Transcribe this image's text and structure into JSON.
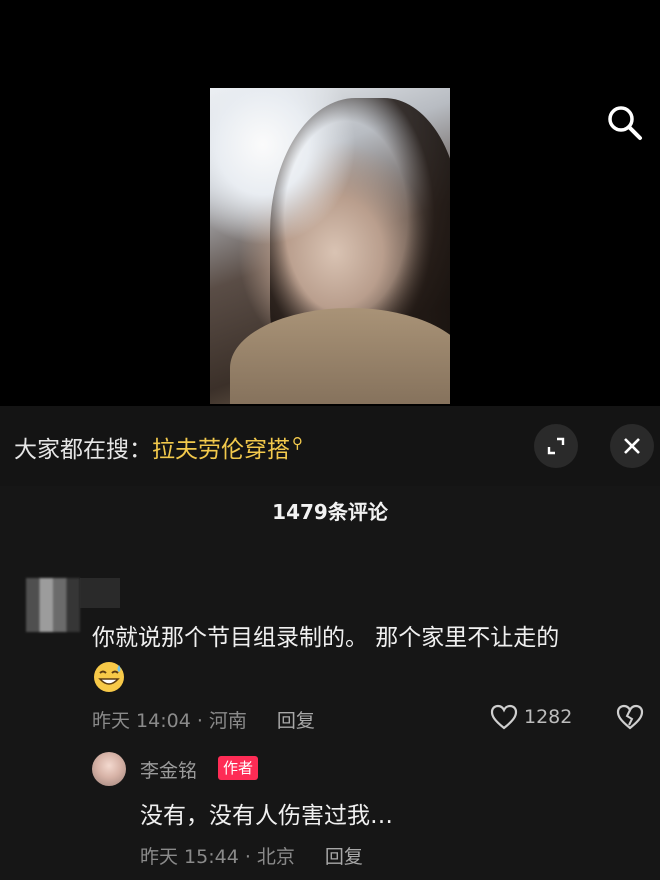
{
  "search": {
    "hint_label": "大家都在搜：",
    "hint_query": "拉夫劳伦穿搭"
  },
  "comments": {
    "count_label": "1479条评论",
    "items": [
      {
        "text": "你就说那个节目组录制的。 那个家里不让走的",
        "time_location": "昨天 14:04 · 河南",
        "reply_label": "回复",
        "like_count": "1282",
        "replies": [
          {
            "user": "李金铭",
            "badge": "作者",
            "text": "没有，没有人伤害过我…",
            "time_location": "昨天 15:44 · 北京",
            "reply_label": "回复"
          }
        ]
      }
    ]
  },
  "icons": {
    "search": "search-icon",
    "expand": "expand-icon",
    "close": "close-icon",
    "like": "heart-icon",
    "dislike": "broken-heart-icon",
    "emoji": "sweat-smile-emoji"
  },
  "colors": {
    "accent": "#f2c94c",
    "badge": "#fe2c55",
    "panel": "#161616"
  }
}
